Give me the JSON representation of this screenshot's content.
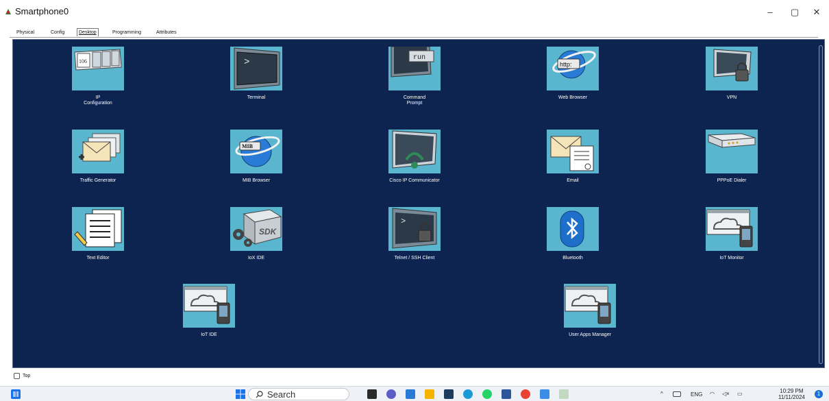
{
  "window": {
    "title": "Smartphone0",
    "controls": {
      "minimize": "–",
      "restore": "▢",
      "close": "✕"
    }
  },
  "tabs": [
    {
      "label": "Physical"
    },
    {
      "label": "Config"
    },
    {
      "label": "Desktop",
      "active": true
    },
    {
      "label": "Programming"
    },
    {
      "label": "Attributes"
    }
  ],
  "apps": [
    {
      "label": "IP\nConfiguration",
      "icon": "ip-configuration-icon",
      "tile_text": "106"
    },
    {
      "label": "Terminal",
      "icon": "terminal-icon",
      "tile_text": ">"
    },
    {
      "label": "Command\nPrompt",
      "icon": "command-prompt-icon",
      "tile_text": "run"
    },
    {
      "label": "Web Browser",
      "icon": "web-browser-icon",
      "tile_text": "http:"
    },
    {
      "label": "VPN",
      "icon": "vpn-icon"
    },
    {
      "label": "Traffic Generator",
      "icon": "traffic-generator-icon"
    },
    {
      "label": "MIB Browser",
      "icon": "mib-browser-icon",
      "tile_text": "MIB"
    },
    {
      "label": "Cisco IP Communicator",
      "icon": "cisco-ip-communicator-icon"
    },
    {
      "label": "Email",
      "icon": "email-icon"
    },
    {
      "label": "PPPoE Dialer",
      "icon": "pppoe-dialer-icon"
    },
    {
      "label": "Text Editor",
      "icon": "text-editor-icon"
    },
    {
      "label": "IoX IDE",
      "icon": "iox-ide-icon",
      "tile_text": "SDK"
    },
    {
      "label": "Telnet / SSH Client",
      "icon": "telnet-ssh-client-icon",
      "tile_text": ">"
    },
    {
      "label": "Bluetooth",
      "icon": "bluetooth-icon"
    },
    {
      "label": "IoT Monitor",
      "icon": "iot-monitor-icon"
    },
    {
      "label": "IoT IDE",
      "icon": "iot-ide-icon"
    },
    {
      "label": "User Apps Manager",
      "icon": "user-apps-manager-icon"
    }
  ],
  "footer": {
    "top_checkbox_label": "Top",
    "top_checked": false
  },
  "taskbar": {
    "search_text": "Search",
    "language": "ENG",
    "time": "10:29 PM",
    "date": "11/11/2024",
    "notifications": "1"
  },
  "colors": {
    "desktop_bg": "#0e2450",
    "tile_bg": "#5ab6ce",
    "label_text": "#ffffff"
  }
}
